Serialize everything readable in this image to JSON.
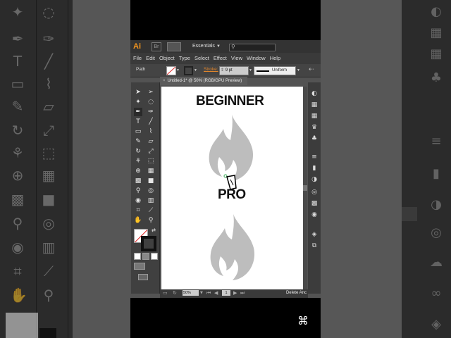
{
  "app": {
    "logo": "Ai",
    "workspace": "Essentials",
    "status_text": "Delete Anc"
  },
  "menu": [
    "File",
    "Edit",
    "Object",
    "Type",
    "Select",
    "Effect",
    "View",
    "Window",
    "Help"
  ],
  "control_bar": {
    "selection_label": "Path",
    "stroke_label": "Stroke:",
    "stroke_value": "9 pt",
    "profile_label": "Uniform"
  },
  "document": {
    "tab_title": "Untitled-1* @ 50% (RGB/GPU Preview)",
    "zoom": "50%",
    "page": "1"
  },
  "canvas": {
    "beginner_text": "BEGINNER",
    "pro_text": "PRO",
    "flame_color": "#bdbdbd",
    "cursor_color": "#2fa84f"
  },
  "colors": {
    "accent": "#f7971e",
    "ui_dark": "#333333",
    "panel": "#404040"
  }
}
